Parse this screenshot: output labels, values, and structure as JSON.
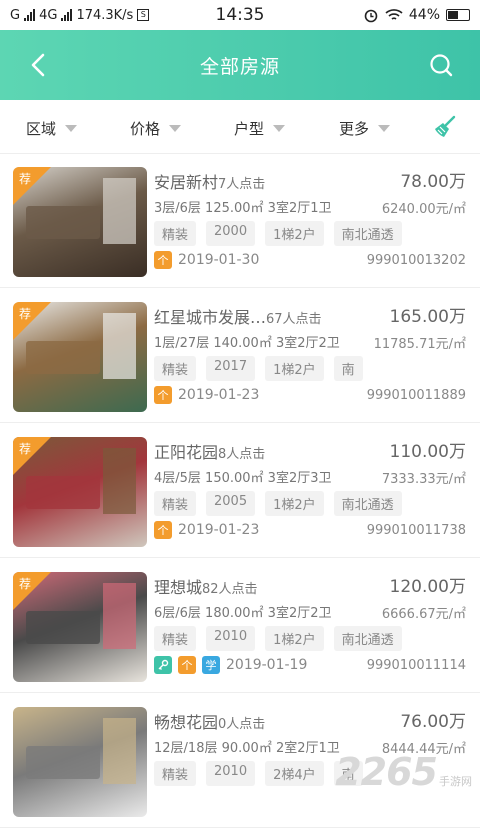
{
  "status_bar": {
    "carrier1": "G",
    "carrier2": "4G",
    "speed": "174.3K/s",
    "speed_icon": "S",
    "time": "14:35",
    "battery": "44%"
  },
  "header": {
    "title": "全部房源"
  },
  "filters": [
    {
      "label": "区域"
    },
    {
      "label": "价格"
    },
    {
      "label": "户型"
    },
    {
      "label": "更多"
    }
  ],
  "listings": [
    {
      "badge": "荐",
      "name": "安居新村",
      "clicks": "7人点击",
      "price": "78.00万",
      "info": "3层/6层  125.00㎡  3室2厅1卫",
      "unit_price": "6240.00元/㎡",
      "tags": [
        "精装",
        "2000",
        "1梯2户",
        "南北通透"
      ],
      "badges": [
        "个"
      ],
      "date": "2019-01-30",
      "id": "999010013202",
      "photo_colors": [
        "#3a2e25",
        "#6b5a48",
        "#d6d2cb"
      ]
    },
    {
      "badge": "荐",
      "name": "红星城市发展…",
      "clicks": "67人点击",
      "price": "165.00万",
      "info": "1层/27层  140.00㎡  3室2厅2卫",
      "unit_price": "11785.71元/㎡",
      "tags": [
        "精装",
        "2017",
        "1梯2户",
        "南"
      ],
      "badges": [
        "个"
      ],
      "date": "2019-01-23",
      "id": "999010011889",
      "photo_colors": [
        "#3d6a50",
        "#8c6a43",
        "#e9e9e7"
      ]
    },
    {
      "badge": "荐",
      "name": "正阳花园",
      "clicks": "8人点击",
      "price": "110.00万",
      "info": "4层/5层  150.00㎡  3室2厅3卫",
      "unit_price": "7333.33元/㎡",
      "tags": [
        "精装",
        "2005",
        "1梯2户",
        "南北通透"
      ],
      "badges": [
        "个"
      ],
      "date": "2019-01-23",
      "id": "999010011738",
      "photo_colors": [
        "#cfc7bd",
        "#a2363c",
        "#7a5a3a"
      ]
    },
    {
      "badge": "荐",
      "name": "理想城",
      "clicks": "82人点击",
      "price": "120.00万",
      "info": "6层/6层  180.00㎡  3室2厅2卫",
      "unit_price": "6666.67元/㎡",
      "tags": [
        "精装",
        "2010",
        "1梯2户",
        "南北通透"
      ],
      "badges": [
        "钥",
        "个",
        "学"
      ],
      "date": "2019-01-19",
      "id": "999010011114",
      "photo_colors": [
        "#e8e4dd",
        "#4a4a4a",
        "#d06a78"
      ]
    },
    {
      "badge": "",
      "name": "畅想花园",
      "clicks": "0人点击",
      "price": "76.00万",
      "info": "12层/18层  90.00㎡  2室2厅1卫",
      "unit_price": "8444.44元/㎡",
      "tags": [
        "精装",
        "2010",
        "2梯4户",
        "南"
      ],
      "badges": [],
      "date": "",
      "id": "",
      "photo_colors": [
        "#eaeaea",
        "#7a7a7a",
        "#c8b48a"
      ]
    }
  ],
  "watermark": {
    "number": "2265",
    "text": "手游网"
  },
  "colors": {
    "header_start": "#5dd6b3",
    "header_end": "#3ec3a8",
    "recommend": "#f39c2d",
    "badge_personal": "#f39c2d",
    "badge_key": "#3ec3a8",
    "badge_school": "#39a8e0"
  }
}
